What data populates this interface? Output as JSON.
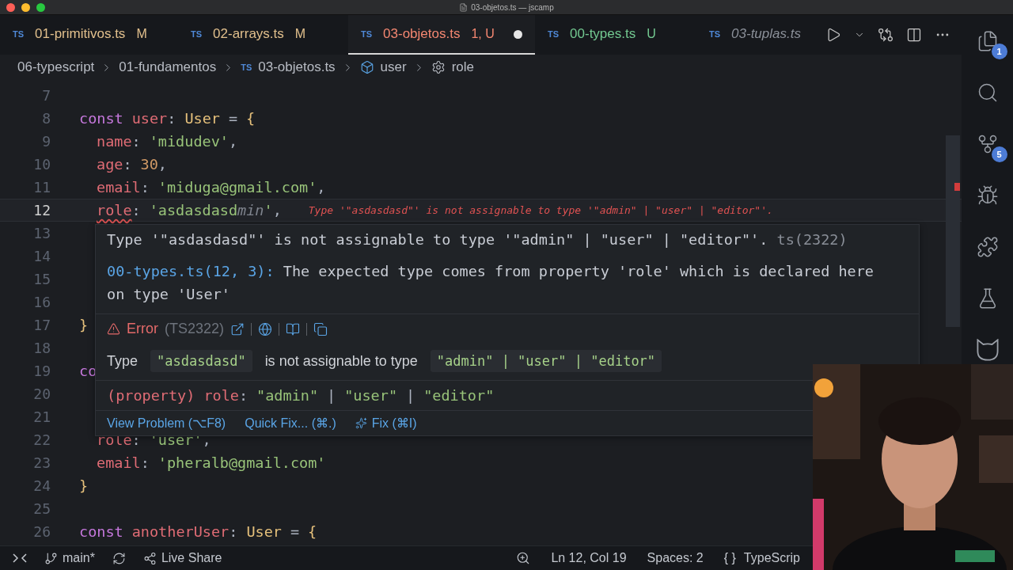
{
  "window": {
    "title": "03-objetos.ts — jscamp"
  },
  "tabs": [
    {
      "badge": "TS",
      "label": "01-primitivos.ts",
      "status": "M",
      "kind": "modified",
      "selected": false,
      "unsaved": false
    },
    {
      "badge": "TS",
      "label": "02-arrays.ts",
      "status": "M",
      "kind": "modified",
      "selected": false,
      "unsaved": false
    },
    {
      "badge": "TS",
      "label": "03-objetos.ts",
      "status": "1, U",
      "kind": "error",
      "selected": true,
      "unsaved": true
    },
    {
      "badge": "TS",
      "label": "00-types.ts",
      "status": "U",
      "kind": "untracked",
      "selected": false,
      "unsaved": false
    },
    {
      "badge": "TS",
      "label": "03-tuplas.ts",
      "kind": "preview",
      "selected": false,
      "unsaved": false
    }
  ],
  "editor_actions": [
    {
      "kind": "run"
    },
    {
      "kind": "dropdown"
    },
    {
      "kind": "compare"
    },
    {
      "kind": "split"
    },
    {
      "kind": "more"
    }
  ],
  "breadcrumbs": [
    {
      "label": "06-typescript",
      "kind": "folder"
    },
    {
      "label": "01-fundamentos",
      "kind": "folder"
    },
    {
      "label": "03-objetos.ts",
      "kind": "file",
      "badge": "TS"
    },
    {
      "label": "user",
      "kind": "object"
    },
    {
      "label": "role",
      "kind": "property"
    }
  ],
  "editor": {
    "lines": [
      {
        "number": "7",
        "current": false
      },
      {
        "number": "8",
        "current": false,
        "indented": false,
        "tokens": [
          {
            "kind": "keyword",
            "text": "const"
          },
          {
            "kind": "variable",
            "text": "user"
          },
          {
            "kind": "punct",
            "text": ":"
          },
          {
            "kind": "type",
            "text": "User"
          },
          {
            "kind": "punct",
            "text": "="
          },
          {
            "kind": "bracket",
            "text": "{"
          }
        ]
      },
      {
        "number": "9",
        "current": false,
        "indented": true,
        "tokens": [
          {
            "kind": "prop",
            "text": "name"
          },
          {
            "kind": "punct",
            "text": ":"
          },
          {
            "kind": "string",
            "text": "'midudev'"
          },
          {
            "kind": "punct",
            "text": ","
          }
        ]
      },
      {
        "number": "10",
        "current": false,
        "indented": true,
        "tokens": [
          {
            "kind": "prop",
            "text": "age"
          },
          {
            "kind": "punct",
            "text": ":"
          },
          {
            "kind": "number",
            "text": "30"
          },
          {
            "kind": "punct",
            "text": ","
          }
        ]
      },
      {
        "number": "11",
        "current": false,
        "indented": true,
        "tokens": [
          {
            "kind": "prop",
            "text": "email"
          },
          {
            "kind": "punct",
            "text": ":"
          },
          {
            "kind": "string",
            "text": "'miduga@gmail.com'"
          },
          {
            "kind": "punct",
            "text": ","
          }
        ]
      },
      {
        "number": "12",
        "current": true,
        "indented": true,
        "tokens": [
          {
            "kind": "error-prop",
            "text": "role"
          },
          {
            "kind": "punct",
            "text": ":"
          },
          {
            "kind": "string",
            "text": "'asdasdasd"
          },
          {
            "kind": "ghost",
            "text": "min"
          },
          {
            "kind": "string",
            "text": "'"
          },
          {
            "kind": "punct",
            "text": ","
          }
        ],
        "diagnostic": "Type '\"asdasdasd\"' is not assignable to type '\"admin\" | \"user\" | \"editor\"'."
      },
      {
        "number": "13",
        "current": false
      },
      {
        "number": "14",
        "current": false
      },
      {
        "number": "15",
        "current": false
      },
      {
        "number": "16",
        "current": false
      },
      {
        "number": "17",
        "current": false,
        "indented": false,
        "tokens": [
          {
            "kind": "bracket",
            "text": "}"
          }
        ]
      },
      {
        "number": "18",
        "current": false
      },
      {
        "number": "19",
        "current": false,
        "indented": false,
        "tokens": [
          {
            "kind": "keyword",
            "text": "co"
          }
        ]
      },
      {
        "number": "20",
        "current": false
      },
      {
        "number": "21",
        "current": false
      },
      {
        "number": "22",
        "current": false,
        "indented": true,
        "tokens": [
          {
            "kind": "prop",
            "text": "role"
          },
          {
            "kind": "punct",
            "text": ":"
          },
          {
            "kind": "string",
            "text": "'user'"
          },
          {
            "kind": "punct",
            "text": ","
          }
        ]
      },
      {
        "number": "23",
        "current": false,
        "indented": true,
        "tokens": [
          {
            "kind": "prop",
            "text": "email"
          },
          {
            "kind": "punct",
            "text": ":"
          },
          {
            "kind": "string",
            "text": "'pheralb@gmail.com'"
          }
        ]
      },
      {
        "number": "24",
        "current": false,
        "indented": false,
        "tokens": [
          {
            "kind": "bracket",
            "text": "}"
          }
        ]
      },
      {
        "number": "25",
        "current": false
      },
      {
        "number": "26",
        "current": false,
        "indented": false,
        "tokens": [
          {
            "kind": "keyword",
            "text": "const"
          },
          {
            "kind": "variable",
            "text": "anotherUser"
          },
          {
            "kind": "punct",
            "text": ":"
          },
          {
            "kind": "type",
            "text": "User"
          },
          {
            "kind": "punct",
            "text": "="
          },
          {
            "kind": "bracket",
            "text": "{"
          }
        ]
      }
    ]
  },
  "hover": {
    "message": "Type '\"asdasdasd\"' is not assignable to type '\"admin\" | \"user\" | \"editor\"'.",
    "source": "ts(2322)",
    "related_link": "00-types.ts(12, 3):",
    "related_text": "The expected type comes from property 'role' which is declared here on type 'User'",
    "error_title": "Error",
    "error_code": "(TS2322)",
    "error_parts": [
      {
        "kind": "text",
        "text": "Type"
      },
      {
        "kind": "code",
        "text": "\"asdasdasd\""
      },
      {
        "kind": "text",
        "text": "is not assignable to type"
      },
      {
        "kind": "code",
        "text": "\"admin\" | \"user\" | \"editor\""
      }
    ],
    "signature": [
      {
        "kind": "meta",
        "text": "(property)"
      },
      {
        "kind": "prop",
        "text": "role"
      },
      {
        "kind": "punct",
        "text": ":"
      },
      {
        "kind": "string",
        "text": "\"admin\""
      },
      {
        "kind": "punct",
        "text": "|"
      },
      {
        "kind": "string",
        "text": "\"user\""
      },
      {
        "kind": "punct",
        "text": "|"
      },
      {
        "kind": "string",
        "text": "\"editor\""
      }
    ],
    "actions": [
      {
        "kind": "link",
        "label": "View Problem (⌥F8)"
      },
      {
        "kind": "link",
        "label": "Quick Fix... (⌘.)"
      },
      {
        "kind": "ai",
        "label": "Fix (⌘I)"
      }
    ]
  },
  "activity_bar": [
    {
      "kind": "explorer",
      "badge": "1"
    },
    {
      "kind": "search"
    },
    {
      "kind": "source-control",
      "badge": "5"
    },
    {
      "kind": "debug"
    },
    {
      "kind": "extensions"
    },
    {
      "kind": "testing"
    },
    {
      "kind": "github"
    }
  ],
  "status_bar": {
    "left": [
      {
        "kind": "remote"
      },
      {
        "kind": "branch",
        "label": "main*"
      },
      {
        "kind": "sync"
      },
      {
        "kind": "live-share",
        "label": "Live Share"
      }
    ],
    "right": [
      {
        "kind": "zoom"
      },
      {
        "kind": "text",
        "label": "Ln 12, Col 19"
      },
      {
        "kind": "text",
        "label": "Spaces: 2"
      },
      {
        "kind": "language",
        "prefix": "{ }",
        "label": "TypeScrip"
      }
    ]
  }
}
